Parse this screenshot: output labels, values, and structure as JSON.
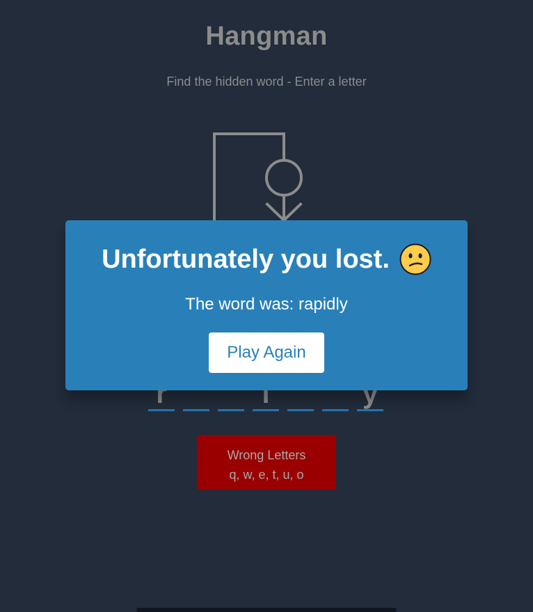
{
  "header": {
    "title": "Hangman",
    "subtitle": "Find the hidden word - Enter a letter"
  },
  "word": {
    "slots": [
      "r",
      "",
      "",
      "i",
      "",
      "",
      "y"
    ]
  },
  "wrong_letters": {
    "label": "Wrong Letters",
    "letters": "q, w, e, t, u, o"
  },
  "popup": {
    "message": "Unfortunately you lost.",
    "reveal": "The word was: rapidly",
    "button_label": "Play Again",
    "emoji": "confused-face-icon"
  },
  "colors": {
    "background": "#222c3a",
    "popup": "#2980b9",
    "wrong_box": "#9b0000",
    "figure": "#8c8c8c"
  }
}
